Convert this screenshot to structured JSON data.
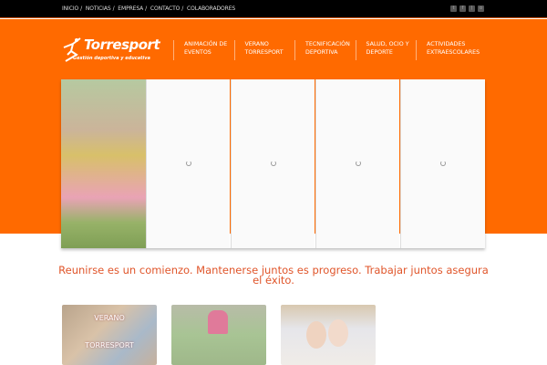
{
  "topbar": {
    "links": [
      "INICIO",
      "NOTICIAS",
      "EMPRESA",
      "CONTACTO",
      "COLABORADORES"
    ],
    "separator": "/",
    "social": [
      "twitter-icon",
      "facebook-icon",
      "rss-icon",
      "search-icon"
    ]
  },
  "logo": {
    "name": "Torresport",
    "tagline": "Gestión deportiva y educativa"
  },
  "nav": [
    {
      "line1": "ANIMACIÓN DE",
      "line2": "EVENTOS"
    },
    {
      "line1": "VERANO",
      "line2": "TORRESPORT"
    },
    {
      "line1": "TECNIFICACIÓN",
      "line2": "DEPORTIVA"
    },
    {
      "line1": "SALUD, OCIO Y",
      "line2": "DEPORTE"
    },
    {
      "line1": "ACTIVIDADES",
      "line2": "EXTRAESCOLARES"
    }
  ],
  "quote": "Reunirse es un comienzo. Mantenerse juntos es progreso. Trabajar juntos asegura el éxito.",
  "thumbs": [
    {
      "line1": "VERANO",
      "line2": "TORRESPORT"
    }
  ],
  "colors": {
    "brand": "#ff6a00",
    "quote": "#e0552a"
  }
}
